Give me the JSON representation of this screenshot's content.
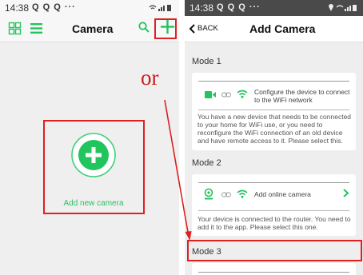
{
  "left_screen": {
    "status_bar": {
      "time": "14:38",
      "icons": "Q Q Q ···"
    },
    "nav": {
      "title": "Camera",
      "grid_icon": "grid-view-icon",
      "list_icon": "list-view-icon",
      "search_icon": "search-icon",
      "add_icon": "plus-icon"
    },
    "add_camera": {
      "label": "Add new camera",
      "icon": "plus-circle-icon"
    }
  },
  "or_label": "or",
  "right_screen": {
    "status_bar": {
      "time": "14:38",
      "icons": "Q Q Q ···"
    },
    "nav": {
      "back_label": "BACK",
      "title": "Add Camera"
    },
    "mode1": {
      "title": "Mode 1",
      "option": "Configure the device to connect to the WiFi network",
      "description": "You have a new device that needs to be connected to your home for WiFi use, or you need to reconfigure the WiFi connection of an old device and have remote access to it. Please select this."
    },
    "mode2": {
      "title": "Mode 2",
      "option": "Add online camera",
      "description": "Your device is connected to the router. You need to add it to the app. Please select this one."
    },
    "mode3": {
      "title": "Mode 3"
    }
  },
  "colors": {
    "accent_green": "#22c45e",
    "highlight_red": "#e02020"
  }
}
